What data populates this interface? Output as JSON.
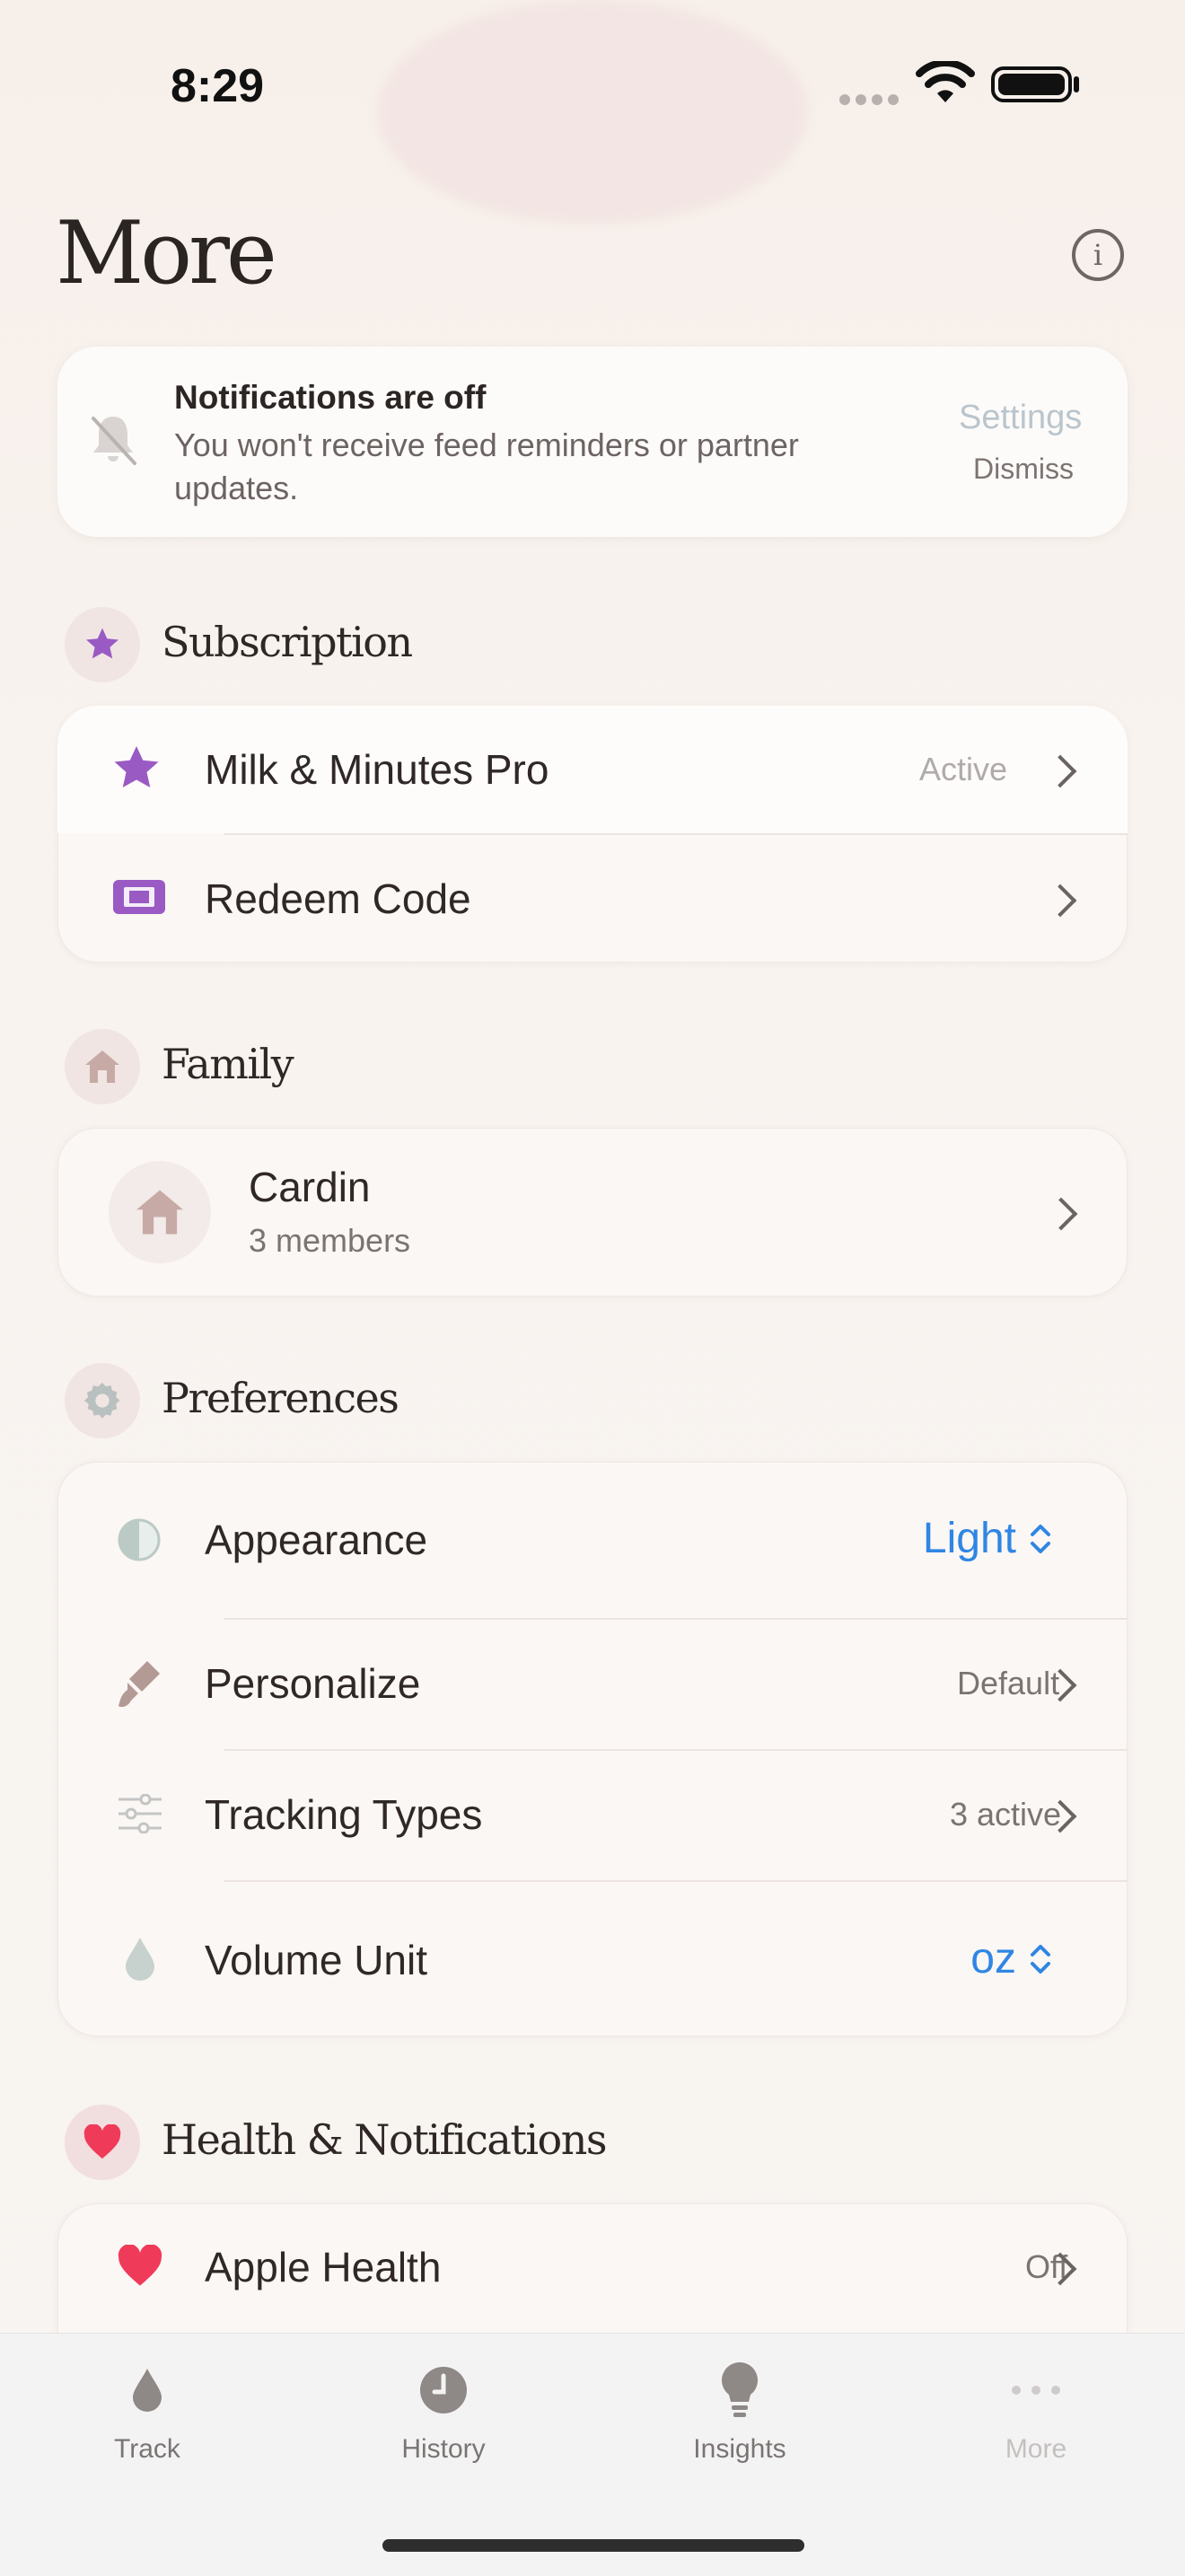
{
  "status_bar": {
    "time": "8:29"
  },
  "header": {
    "title": "More"
  },
  "notification_banner": {
    "title": "Notifications are off",
    "body": "You won't receive feed reminders or partner updates.",
    "settings_label": "Settings",
    "dismiss_label": "Dismiss"
  },
  "subscription": {
    "title": "Subscription",
    "items": [
      {
        "label": "Milk & Minutes Pro",
        "value": "Active",
        "icon": "star-icon"
      },
      {
        "label": "Redeem Code",
        "value": "",
        "icon": "ticket-icon"
      }
    ]
  },
  "family": {
    "title": "Family",
    "name": "Cardin",
    "members": "3 members"
  },
  "preferences": {
    "title": "Preferences",
    "items": [
      {
        "label": "Appearance",
        "value": "Light",
        "icon": "half-circle-icon"
      },
      {
        "label": "Personalize",
        "value": "Default",
        "icon": "paintbrush-icon"
      },
      {
        "label": "Tracking Types",
        "value": "3 active",
        "icon": "sliders-icon"
      },
      {
        "label": "Volume Unit",
        "value": "oz",
        "icon": "drop-icon"
      }
    ]
  },
  "health": {
    "title": "Health & Notifications",
    "items": [
      {
        "label": "Apple Health",
        "value": "Off",
        "icon": "heart-icon"
      }
    ]
  },
  "tabbar": {
    "tabs": [
      {
        "label": "Track",
        "icon": "drop-icon"
      },
      {
        "label": "History",
        "icon": "clock-icon"
      },
      {
        "label": "Insights",
        "icon": "lightbulb-icon"
      },
      {
        "label": "More",
        "icon": "ellipsis-icon"
      }
    ]
  },
  "colors": {
    "accent_blue": "#2f86e3",
    "purple": "#9a5ac4",
    "heart_red": "#f03a5a",
    "brown_icon": "#b39a95"
  }
}
